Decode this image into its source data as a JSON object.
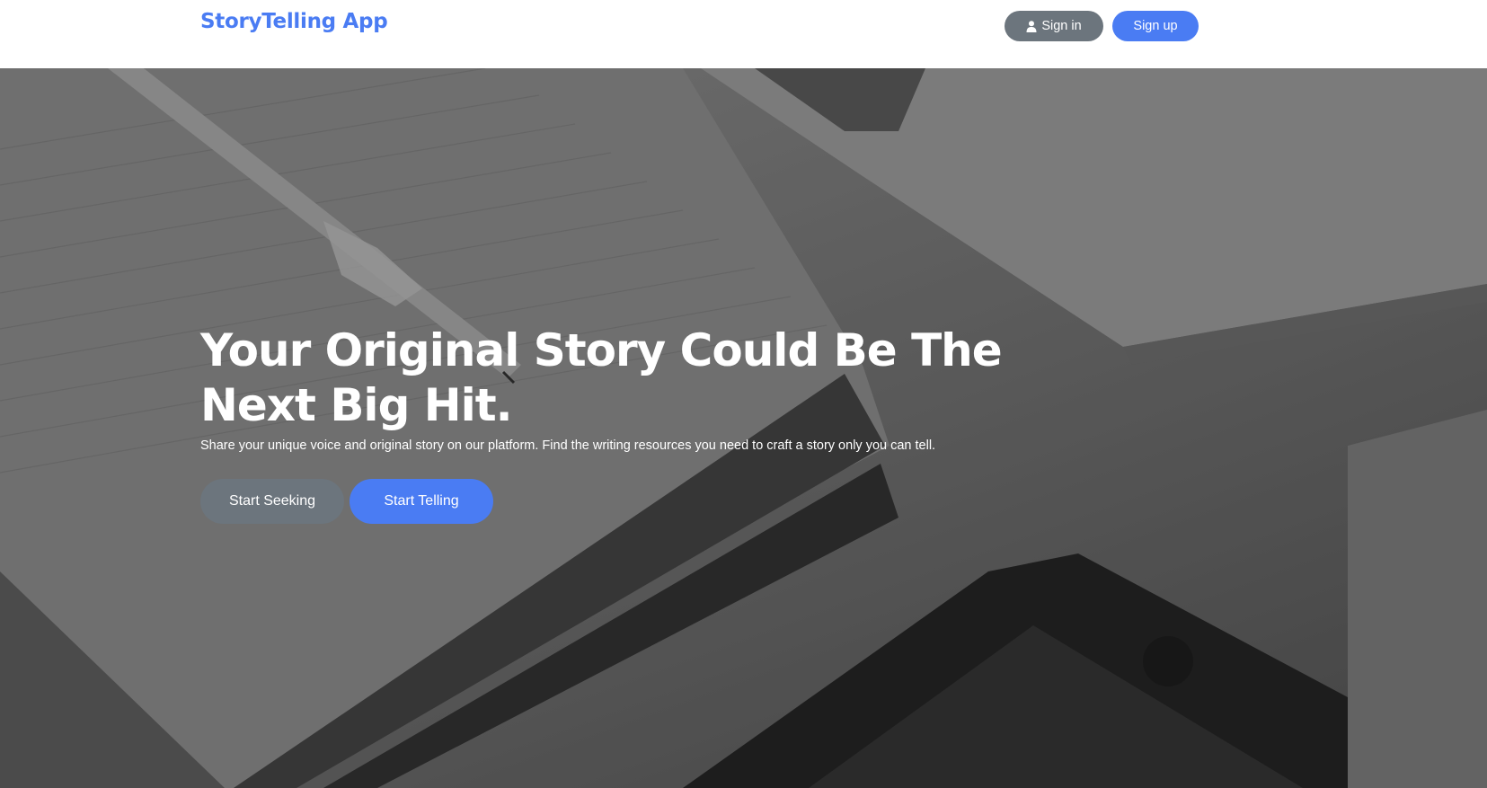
{
  "brand": {
    "name": "StoryTelling App"
  },
  "nav": {
    "signin_label": "Sign in",
    "signup_label": "Sign up",
    "signin_icon": "user-icon"
  },
  "hero": {
    "title": "Your Original Story Could Be The Next Big Hit.",
    "subtitle": "Share your unique voice and original story on our platform. Find the writing resources you need to craft a story only you can tell.",
    "seek_label": "Start Seeking",
    "tell_label": "Start Telling",
    "background": "grayscale photo of notebook, pen, laptop and phone on desk"
  },
  "colors": {
    "accent": "#4a7cf3",
    "secondary": "#6c757d",
    "text_on_dark": "#ffffff"
  }
}
